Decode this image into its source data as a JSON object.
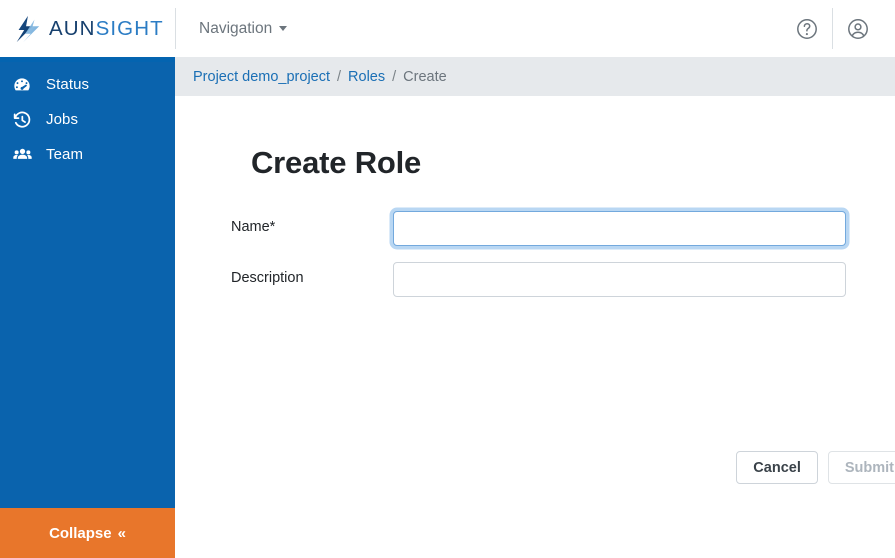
{
  "header": {
    "brand": {
      "logo_icon": "aunsight-logo-icon",
      "text_primary": "AUN",
      "text_secondary": "SIGHT"
    },
    "navigation": {
      "label": "Navigation",
      "caret_icon": "chevron-down-icon"
    },
    "help_icon": "help-circle-icon",
    "account_icon": "account-circle-icon"
  },
  "sidebar": {
    "items": [
      {
        "label": "Status",
        "icon": "speedometer-icon"
      },
      {
        "label": "Jobs",
        "icon": "history-icon"
      },
      {
        "label": "Team",
        "icon": "people-group-icon"
      }
    ],
    "collapse": {
      "label": "Collapse",
      "icon": "double-chevron-left-icon",
      "glyph": "«"
    }
  },
  "breadcrumb": {
    "items": [
      {
        "label": "Project demo_project",
        "current": false
      },
      {
        "label": "Roles",
        "current": false
      },
      {
        "label": "Create",
        "current": true
      }
    ],
    "separator": "/"
  },
  "main": {
    "title": "Create Role",
    "fields": [
      {
        "label": "Name*",
        "value": "",
        "placeholder": "",
        "focused": true
      },
      {
        "label": "Description",
        "value": "",
        "placeholder": "",
        "focused": false
      }
    ],
    "buttons": {
      "cancel": "Cancel",
      "submit": "Submit"
    }
  },
  "colors": {
    "sidebar_blue": "#0a63ad",
    "collapse_orange": "#e8762b",
    "link_blue": "#1a6fb5",
    "breadcrumb_bg": "#e6e9ec",
    "focus_ring": "#80b7ea"
  }
}
